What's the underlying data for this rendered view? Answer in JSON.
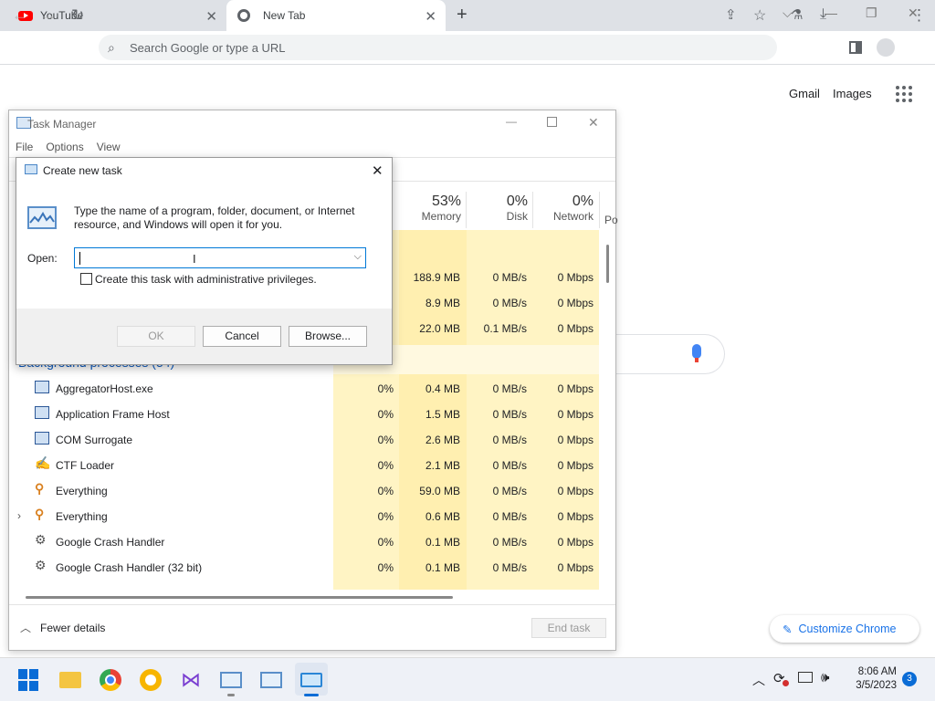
{
  "browser": {
    "tabs": [
      {
        "title": "YouTube",
        "active": false
      },
      {
        "title": "New Tab",
        "active": true
      }
    ],
    "omnibox_placeholder": "Search Google or type a URL",
    "icons": [
      "back-icon",
      "forward-icon",
      "reload-icon",
      "search-icon",
      "share-icon",
      "star-icon",
      "labs-icon",
      "download-icon",
      "sidebar-icon",
      "profile-icon",
      "menu-icon"
    ]
  },
  "google_page": {
    "gmail": "Gmail",
    "images": "Images",
    "customize": "Customize Chrome"
  },
  "task_manager": {
    "title": "Task Manager",
    "menu": [
      "File",
      "Options",
      "View"
    ],
    "columns": [
      {
        "pct": "53%",
        "label": "Memory"
      },
      {
        "pct": "0%",
        "label": "Disk"
      },
      {
        "pct": "0%",
        "label": "Network"
      },
      {
        "pct": "",
        "label": "Po"
      }
    ],
    "apps_rows": [
      {
        "memory": "188.9 MB",
        "disk": "0 MB/s",
        "network": "0 Mbps"
      },
      {
        "memory": "8.9 MB",
        "disk": "0 MB/s",
        "network": "0 Mbps"
      },
      {
        "memory": "22.0 MB",
        "disk": "0.1 MB/s",
        "network": "0 Mbps"
      }
    ],
    "background_header": "Background processes (54)",
    "processes": [
      {
        "name": "AggregatorHost.exe",
        "cpu": "0%",
        "memory": "0.4 MB",
        "disk": "0 MB/s",
        "network": "0 Mbps",
        "icon": "window-icon"
      },
      {
        "name": "Application Frame Host",
        "cpu": "0%",
        "memory": "1.5 MB",
        "disk": "0 MB/s",
        "network": "0 Mbps",
        "icon": "window-icon"
      },
      {
        "name": "COM Surrogate",
        "cpu": "0%",
        "memory": "2.6 MB",
        "disk": "0 MB/s",
        "network": "0 Mbps",
        "icon": "window-icon"
      },
      {
        "name": "CTF Loader",
        "cpu": "0%",
        "memory": "2.1 MB",
        "disk": "0 MB/s",
        "network": "0 Mbps",
        "icon": "pen-icon"
      },
      {
        "name": "Everything",
        "cpu": "0%",
        "memory": "59.0 MB",
        "disk": "0 MB/s",
        "network": "0 Mbps",
        "icon": "magnifier-icon"
      },
      {
        "name": "Everything",
        "cpu": "0%",
        "memory": "0.6 MB",
        "disk": "0 MB/s",
        "network": "0 Mbps",
        "icon": "magnifier-icon"
      },
      {
        "name": "Google Crash Handler",
        "cpu": "0%",
        "memory": "0.1 MB",
        "disk": "0 MB/s",
        "network": "0 Mbps",
        "icon": "crash-icon"
      },
      {
        "name": "Google Crash Handler (32 bit)",
        "cpu": "0%",
        "memory": "0.1 MB",
        "disk": "0 MB/s",
        "network": "0 Mbps",
        "icon": "crash-icon"
      }
    ],
    "fewer_details": "Fewer details",
    "end_task": "End task"
  },
  "dialog": {
    "title": "Create new task",
    "description": "Type the name of a program, folder, document, or Internet resource, and Windows will open it for you.",
    "open_label": "Open:",
    "open_value": "",
    "admin_label": "Create this task with administrative privileges.",
    "ok": "OK",
    "cancel": "Cancel",
    "browse": "Browse..."
  },
  "taskbar": {
    "time": "8:06 AM",
    "date": "3/5/2023",
    "notifications": "3"
  }
}
